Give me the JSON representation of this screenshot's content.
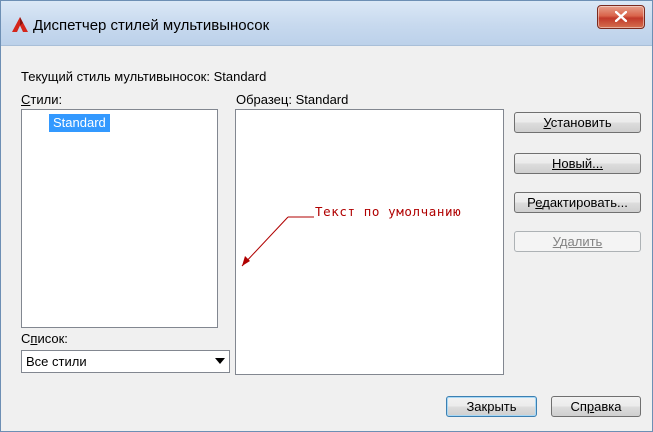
{
  "window": {
    "title": "Диспетчер стилей мультивыносок",
    "app_icon": "autocad-a-icon",
    "close_icon": "close-x-icon"
  },
  "current_style": {
    "label": "Текущий стиль мультивыносок:",
    "value": "Standard"
  },
  "styles": {
    "label_first": "С",
    "label_rest": "тили:",
    "items": [
      "Standard"
    ],
    "selected": "Standard"
  },
  "preview": {
    "label": "Образец:",
    "value": "Standard",
    "leader_text": "Текст по умолчанию"
  },
  "list_filter": {
    "label_first": "С",
    "label_mid": "п",
    "label_rest": "исок:",
    "value": "Все стили"
  },
  "buttons": {
    "set_current": {
      "u": "У",
      "rest": "становить"
    },
    "new": {
      "u": "Н",
      "rest": "овый..."
    },
    "modify": {
      "pre": "Р",
      "u": "е",
      "rest": "дактировать..."
    },
    "delete": {
      "u": "У",
      "rest": "далить",
      "enabled": false
    },
    "close": "Закрыть",
    "help": {
      "pre": "Сп",
      "u": "р",
      "rest": "авка"
    }
  },
  "colors": {
    "selection": "#3399ff",
    "leader": "#b00000",
    "titlebar": "#c7d9ee"
  }
}
